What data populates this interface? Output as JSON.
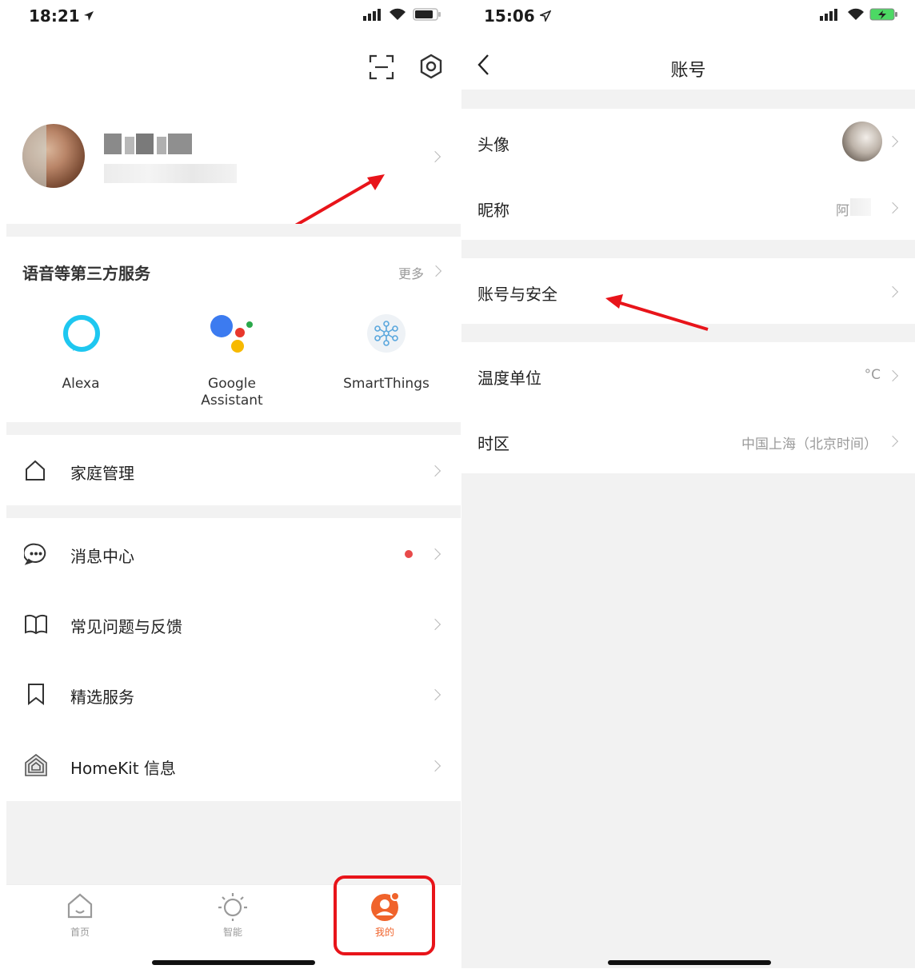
{
  "left": {
    "status": {
      "time": "18:21"
    },
    "services": {
      "title": "语音等第三方服务",
      "more": "更多",
      "items": [
        {
          "label": "Alexa"
        },
        {
          "label": "Google\nAssistant"
        },
        {
          "label": "SmartThings"
        }
      ]
    },
    "menu": [
      {
        "label": "家庭管理",
        "icon": "house-icon"
      },
      {
        "label": "消息中心",
        "icon": "chat-bubble-icon"
      },
      {
        "label": "常见问题与反馈",
        "icon": "book-icon"
      },
      {
        "label": "精选服务",
        "icon": "bookmark-icon"
      },
      {
        "label": "HomeKit 信息",
        "icon": "homekit-icon"
      }
    ],
    "tabs": [
      {
        "label": "首页",
        "icon": "home-icon"
      },
      {
        "label": "智能",
        "icon": "sun-icon"
      },
      {
        "label": "我的",
        "icon": "profile-icon"
      }
    ],
    "colors": {
      "accent": "#f0632b",
      "highlight": "#e8141a",
      "dot": "#e84a4a"
    }
  },
  "right": {
    "status": {
      "time": "15:06"
    },
    "title": "账号",
    "rows": [
      {
        "label": "头像",
        "value": ""
      },
      {
        "label": "昵称",
        "value": "阿"
      },
      {
        "label": "账号与安全",
        "value": ""
      },
      {
        "label": "温度单位",
        "value": "°C"
      },
      {
        "label": "时区",
        "value": "中国上海（北京时间）"
      }
    ]
  }
}
